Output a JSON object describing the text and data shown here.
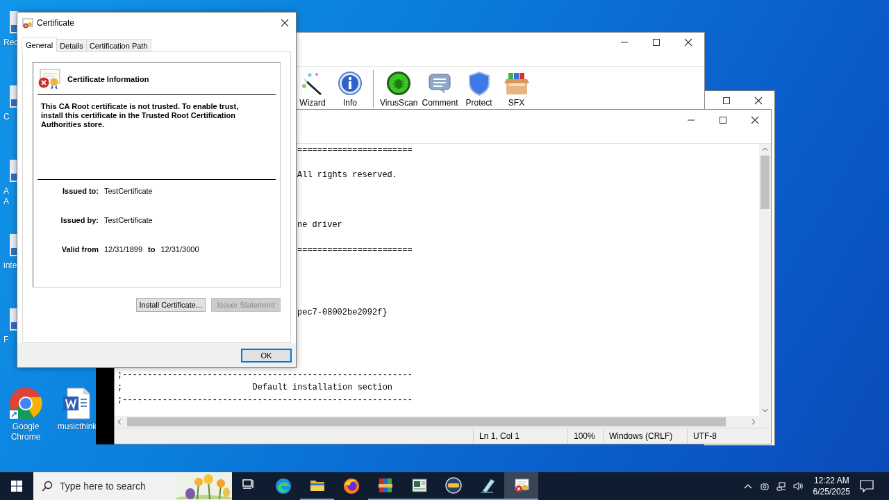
{
  "desktop_icons": [
    {
      "kind": "partial",
      "label": "Rec"
    },
    {
      "kind": "partial",
      "label": "C"
    },
    {
      "kind": "partial",
      "label": "A\nA"
    },
    {
      "kind": "partial",
      "label": "inte"
    },
    {
      "kind": "partial",
      "label": "F"
    },
    {
      "kind": "chrome",
      "label": "Google Chrome"
    },
    {
      "kind": "word",
      "label": "musicthink"
    }
  ],
  "archiver_window": {
    "toolbar": [
      {
        "kind": "wizard",
        "label": "Wizard"
      },
      {
        "kind": "info",
        "label": "Info"
      },
      {
        "kind": "separator"
      },
      {
        "kind": "virusscan",
        "label": "VirusScan"
      },
      {
        "kind": "comment",
        "label": "Comment"
      },
      {
        "kind": "protect",
        "label": "Protect"
      },
      {
        "kind": "sfx",
        "label": "SFX"
      }
    ]
  },
  "notepad": {
    "lines": [
      {
        "kind": "clipped",
        "text": "======================="
      },
      {
        "kind": "blank"
      },
      {
        "kind": "clipped",
        "text": "All rights reserved."
      },
      {
        "kind": "blank"
      },
      {
        "kind": "blank"
      },
      {
        "kind": "blank"
      },
      {
        "kind": "clipped",
        "text": "ne driver"
      },
      {
        "kind": "blank"
      },
      {
        "kind": "clipped",
        "text": "======================="
      },
      {
        "kind": "blank"
      },
      {
        "kind": "blank"
      },
      {
        "kind": "blank"
      },
      {
        "kind": "blank"
      },
      {
        "kind": "clipped",
        "text": "pec7-08002be2092f}"
      },
      {
        "kind": "blank"
      },
      {
        "kind": "blank"
      },
      {
        "kind": "blank"
      },
      {
        "kind": "blank"
      },
      {
        "kind": "full",
        "text": ";----------------------------------------------------------"
      },
      {
        "kind": "full",
        "text": ";                          Default installation section"
      },
      {
        "kind": "full",
        "text": ";----------------------------------------------------------"
      }
    ],
    "status_bar": [
      "Ln 1, Col 1",
      "100%",
      "Windows (CRLF)",
      "UTF-8"
    ]
  },
  "dialog": {
    "title": "Certificate",
    "tabs": [
      {
        "label": "General",
        "selected": true
      },
      {
        "label": "Details",
        "selected": false
      },
      {
        "label": "Certification Path",
        "selected": false
      }
    ],
    "heading": "Certificate Information",
    "message": "This CA Root certificate is not trusted. To enable trust, install this certificate in the Trusted Root Certification Authorities store.",
    "fields": [
      {
        "label": "Issued to:",
        "value": "TestCertificate"
      },
      {
        "label": "Issued by:",
        "value": "TestCertificate"
      }
    ],
    "validity": {
      "label": "Valid from",
      "from": "12/31/1899",
      "to_label": "to",
      "to": "12/31/3000"
    },
    "buttons": [
      {
        "label": "Install Certificate...",
        "disabled": false
      },
      {
        "label": "Issuer Statement",
        "disabled": true
      }
    ],
    "ok": "OK"
  },
  "taskbar": {
    "search": {
      "placeholder": "Type here to search"
    },
    "apps": [
      {
        "kind": "taskview",
        "running": false,
        "selected": false
      },
      {
        "kind": "edge",
        "running": false,
        "selected": false
      },
      {
        "kind": "explorer",
        "running": true,
        "selected": false
      },
      {
        "kind": "firefox",
        "running": false,
        "selected": false
      },
      {
        "kind": "archiver",
        "running": true,
        "selected": false
      },
      {
        "kind": "notepad",
        "running": true,
        "selected": false
      },
      {
        "kind": "ram",
        "running": true,
        "selected": false
      },
      {
        "kind": "pen",
        "running": true,
        "selected": false
      },
      {
        "kind": "certificate",
        "running": true,
        "selected": true
      }
    ],
    "time": "12:22 AM",
    "date": "6/25/2025"
  }
}
